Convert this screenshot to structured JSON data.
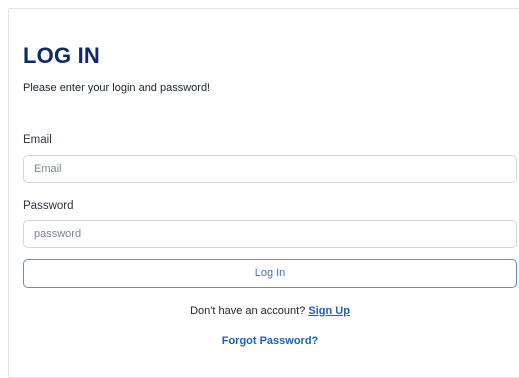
{
  "login": {
    "title": "LOG IN",
    "subtitle": "Please enter your login and password!",
    "email_label": "Email",
    "email_placeholder": "Email",
    "password_label": "Password",
    "password_placeholder": "password",
    "submit_label": "Log In",
    "signup_prompt": "Don't have an account?",
    "signup_link": "Sign Up",
    "forgot_link": "Forgot Password?"
  },
  "colors": {
    "title": "#0b2a6b",
    "link": "#1f5fbf",
    "button_border": "#5d8ed1",
    "input_border": "#cfd6df"
  }
}
